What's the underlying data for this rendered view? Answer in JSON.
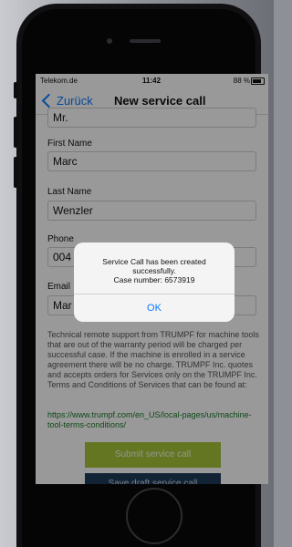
{
  "status_bar": {
    "carrier": "Telekom.de",
    "time": "11:42",
    "battery": "88 %"
  },
  "nav": {
    "back_label": "Zurück",
    "title": "New service call"
  },
  "form": {
    "title_value": "Mr.",
    "first_name_label": "First Name",
    "first_name_value": "Marc",
    "last_name_label": "Last Name",
    "last_name_value": "Wenzler",
    "phone_label": "Phone",
    "phone_value": "004",
    "email_label": "Email",
    "email_value": "Mar"
  },
  "disclaimer": "Technical remote support from TRUMPF for machine tools that are out of the warranty period will be charged per successful case. If the machine is enrolled in a service agreement there will be no charge. TRUMPF Inc. quotes and accepts orders for Services only on the TRUMPF Inc. Terms and Conditions of Services that can be found at:",
  "terms_link": "https://www.trumpf.com/en_US/local-pages/us/machine-tool-terms-conditions/",
  "buttons": {
    "submit": "Submit service call",
    "second": "Save draft service call"
  },
  "alert": {
    "line1": "Service Call has been created",
    "line2": "successfully.",
    "line3": "Case number: 6573919",
    "ok_label": "OK"
  },
  "colors": {
    "accent_green": "#a7c53a",
    "ios_blue": "#0a7aff",
    "navy": "#1e3b5a"
  }
}
